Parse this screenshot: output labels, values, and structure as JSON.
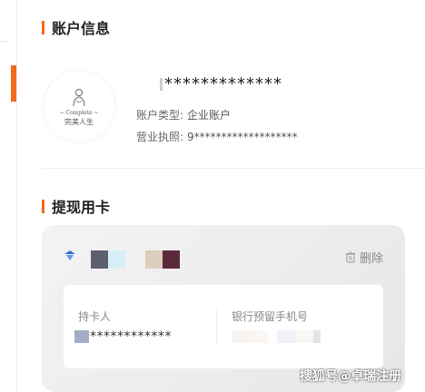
{
  "account_section": {
    "title": "账户信息",
    "account_number": "*************",
    "type_label": "账户类型:",
    "type_value": "企业账户",
    "license_label": "营业执照:",
    "license_value": "9*******************",
    "avatar": {
      "brand_en": "~ Complete ~",
      "brand_cn": "完美人生"
    }
  },
  "card_section": {
    "title": "提现用卡",
    "delete_label": "删除",
    "holder_label": "持卡人",
    "holder_value": "************",
    "phone_label": "银行预留手机号",
    "bank_icon": "bank-logo-icon"
  },
  "watermark": "搜狐号@卓瑞注册",
  "colors": {
    "accent": "#f26b1d"
  }
}
